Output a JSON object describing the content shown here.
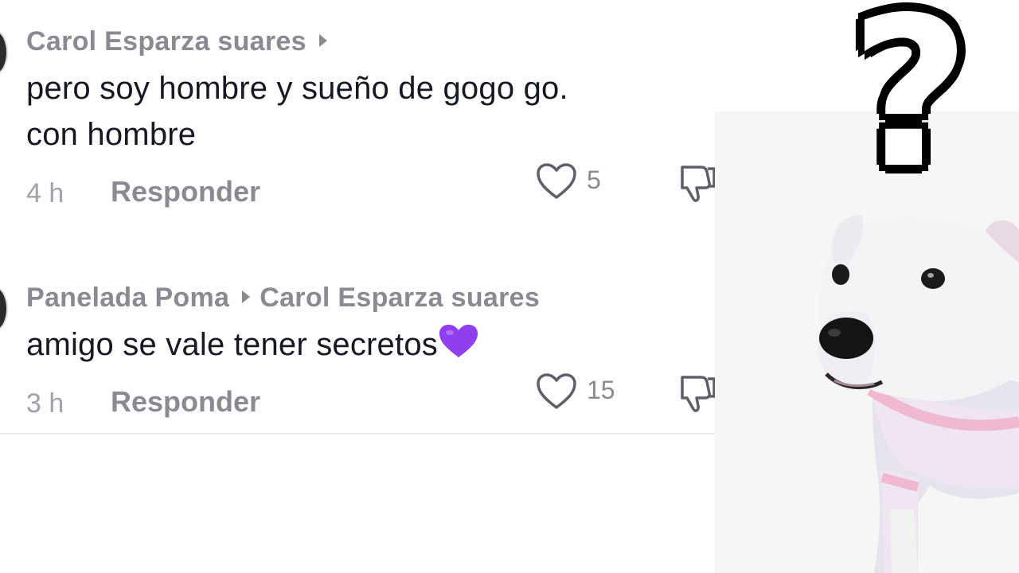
{
  "comments": [
    {
      "author": "Carol Esparza suares",
      "reply_to": "",
      "text_line1": "pero soy hombre y sueño de gogo go.",
      "text_line2": "con hombre",
      "time": "4 h",
      "reply_label": "Responder",
      "likes": "5"
    },
    {
      "author": "Panelada Poma",
      "reply_to": "Carol Esparza suares",
      "text": "amigo se vale tener secretos",
      "emoji": "purple-heart",
      "time": "3 h",
      "reply_label": "Responder",
      "likes": "15"
    }
  ],
  "meme": {
    "question_mark": "?",
    "image": "white-dog-in-pink-sweater"
  },
  "colors": {
    "text": "#161823",
    "muted": "#8a8b91",
    "heart": "#8f3ef0"
  }
}
